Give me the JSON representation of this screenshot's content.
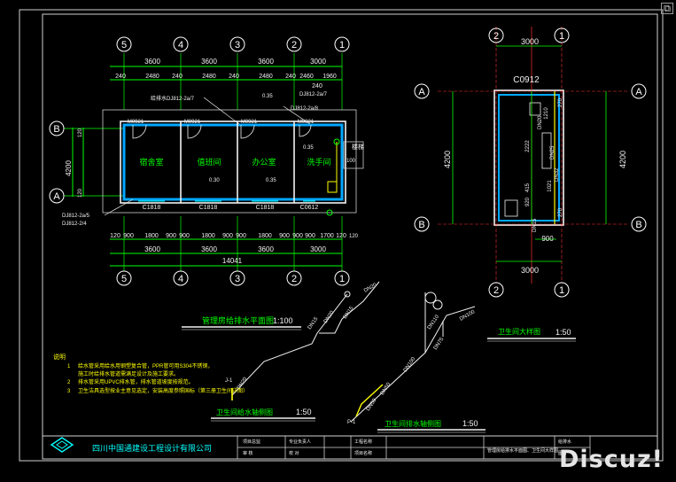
{
  "colors": {
    "background": "#000000",
    "frame": "#d0d0d0",
    "wall": "#f2f2f2",
    "axis": "#ff3030",
    "dim": "#00ff00",
    "grid_bubble": "#ffffff",
    "label": "#00ff00",
    "hatch": "#00a8ff",
    "pipe": "#ffff00",
    "note_title": "#ff8000",
    "title_block": "#00ffff"
  },
  "plan": {
    "top_axes": [
      "5",
      "4",
      "3",
      "2",
      "1"
    ],
    "bottom_axes": [
      "5",
      "4",
      "3",
      "2",
      "1"
    ],
    "left_axes": [
      "B",
      "A"
    ],
    "dim_row1": [
      "3600",
      "3600",
      "3600",
      "3000"
    ],
    "dim_row2": [
      "240",
      "2480",
      "240",
      "2480",
      "240",
      "2480",
      "240",
      "2460",
      "240",
      "1960"
    ],
    "dim_bottom1": [
      "120",
      "900",
      "1800",
      "900",
      "900",
      "1800",
      "900",
      "900",
      "1800",
      "900",
      "900",
      "900",
      "1700",
      "120"
    ],
    "dim_bottom2": [
      "3600",
      "3600",
      "3600",
      "3000"
    ],
    "dim_total": "14041",
    "left_dims": [
      "4200",
      "120",
      "120"
    ],
    "rooms": [
      "宿舍室",
      "值班间",
      "办公室",
      "洗手间"
    ],
    "doors": [
      "M0921",
      "M0921",
      "M0921",
      "M0821"
    ],
    "windows": [
      "C1818",
      "C1818",
      "C1818",
      "C0612"
    ],
    "callouts": [
      "给排水DJ812-2a/7",
      "DJ812-2a/7",
      "DJ812-2a/8",
      "DJ812-2a/5",
      "DJ812-2/4"
    ],
    "stair_label": "楼梯",
    "small_marks": [
      "0.35",
      "0.35",
      "0.30",
      "0.35",
      "100",
      "120"
    ],
    "title": "管理房给排水平面图",
    "scale": "1:100"
  },
  "detail": {
    "top_axes": [
      "2",
      "1"
    ],
    "bottom_axes": [
      "2",
      "1"
    ],
    "side_axes": [
      "A",
      "B"
    ],
    "top_dim": "3000",
    "bottom_dim": "3000",
    "bottom_inner": "900",
    "left_dim": "4200",
    "right_dim": "4200",
    "window": "C0912",
    "vertical_dims": [
      "2222",
      "920",
      "415",
      "1210",
      "270",
      "270",
      "1021"
    ],
    "pipe_labels": [
      "DN20",
      "DN25",
      "DN32",
      "DN15"
    ],
    "title": "卫生间大样图",
    "scale": "1:50"
  },
  "iso_supply": {
    "labels": [
      "DN20",
      "DN15",
      "DN20",
      "DN15",
      "DN20",
      "J-1"
    ],
    "title": "卫生间给水轴侧图",
    "scale": "1:50"
  },
  "iso_drain": {
    "labels": [
      "DN50",
      "DN50",
      "DN100",
      "DN110",
      "DN75",
      "DN100",
      "P-1"
    ],
    "title": "卫生间排水轴侧图",
    "scale": "1:50"
  },
  "notes": {
    "heading": "说明",
    "items": [
      {
        "num": "1",
        "text": "给水管采用给水用钢塑复合管，PPR管可用S304不锈钢，"
      },
      {
        "num": "",
        "text": "施工时给排水管道需满足设计及施工要求。"
      },
      {
        "num": "2",
        "text": "排水管采用UPVC排水管，排水管道坡度按规范。"
      },
      {
        "num": "3",
        "text": "卫生洁具选型按业主意见选定，安装高度参照国标（第三册卫生间详图）"
      }
    ]
  },
  "title_block": {
    "company": "四川中国通建设工程设计有限公司",
    "cells": [
      "项目总监",
      "审 核",
      "专业负责人",
      "校 对",
      "工程名称",
      "项目名称",
      "给排水",
      "图号"
    ],
    "drawing_title": "管理房给排水平面图、卫生间大样图"
  },
  "watermark": "Discuz!",
  "window_button": "⧉"
}
